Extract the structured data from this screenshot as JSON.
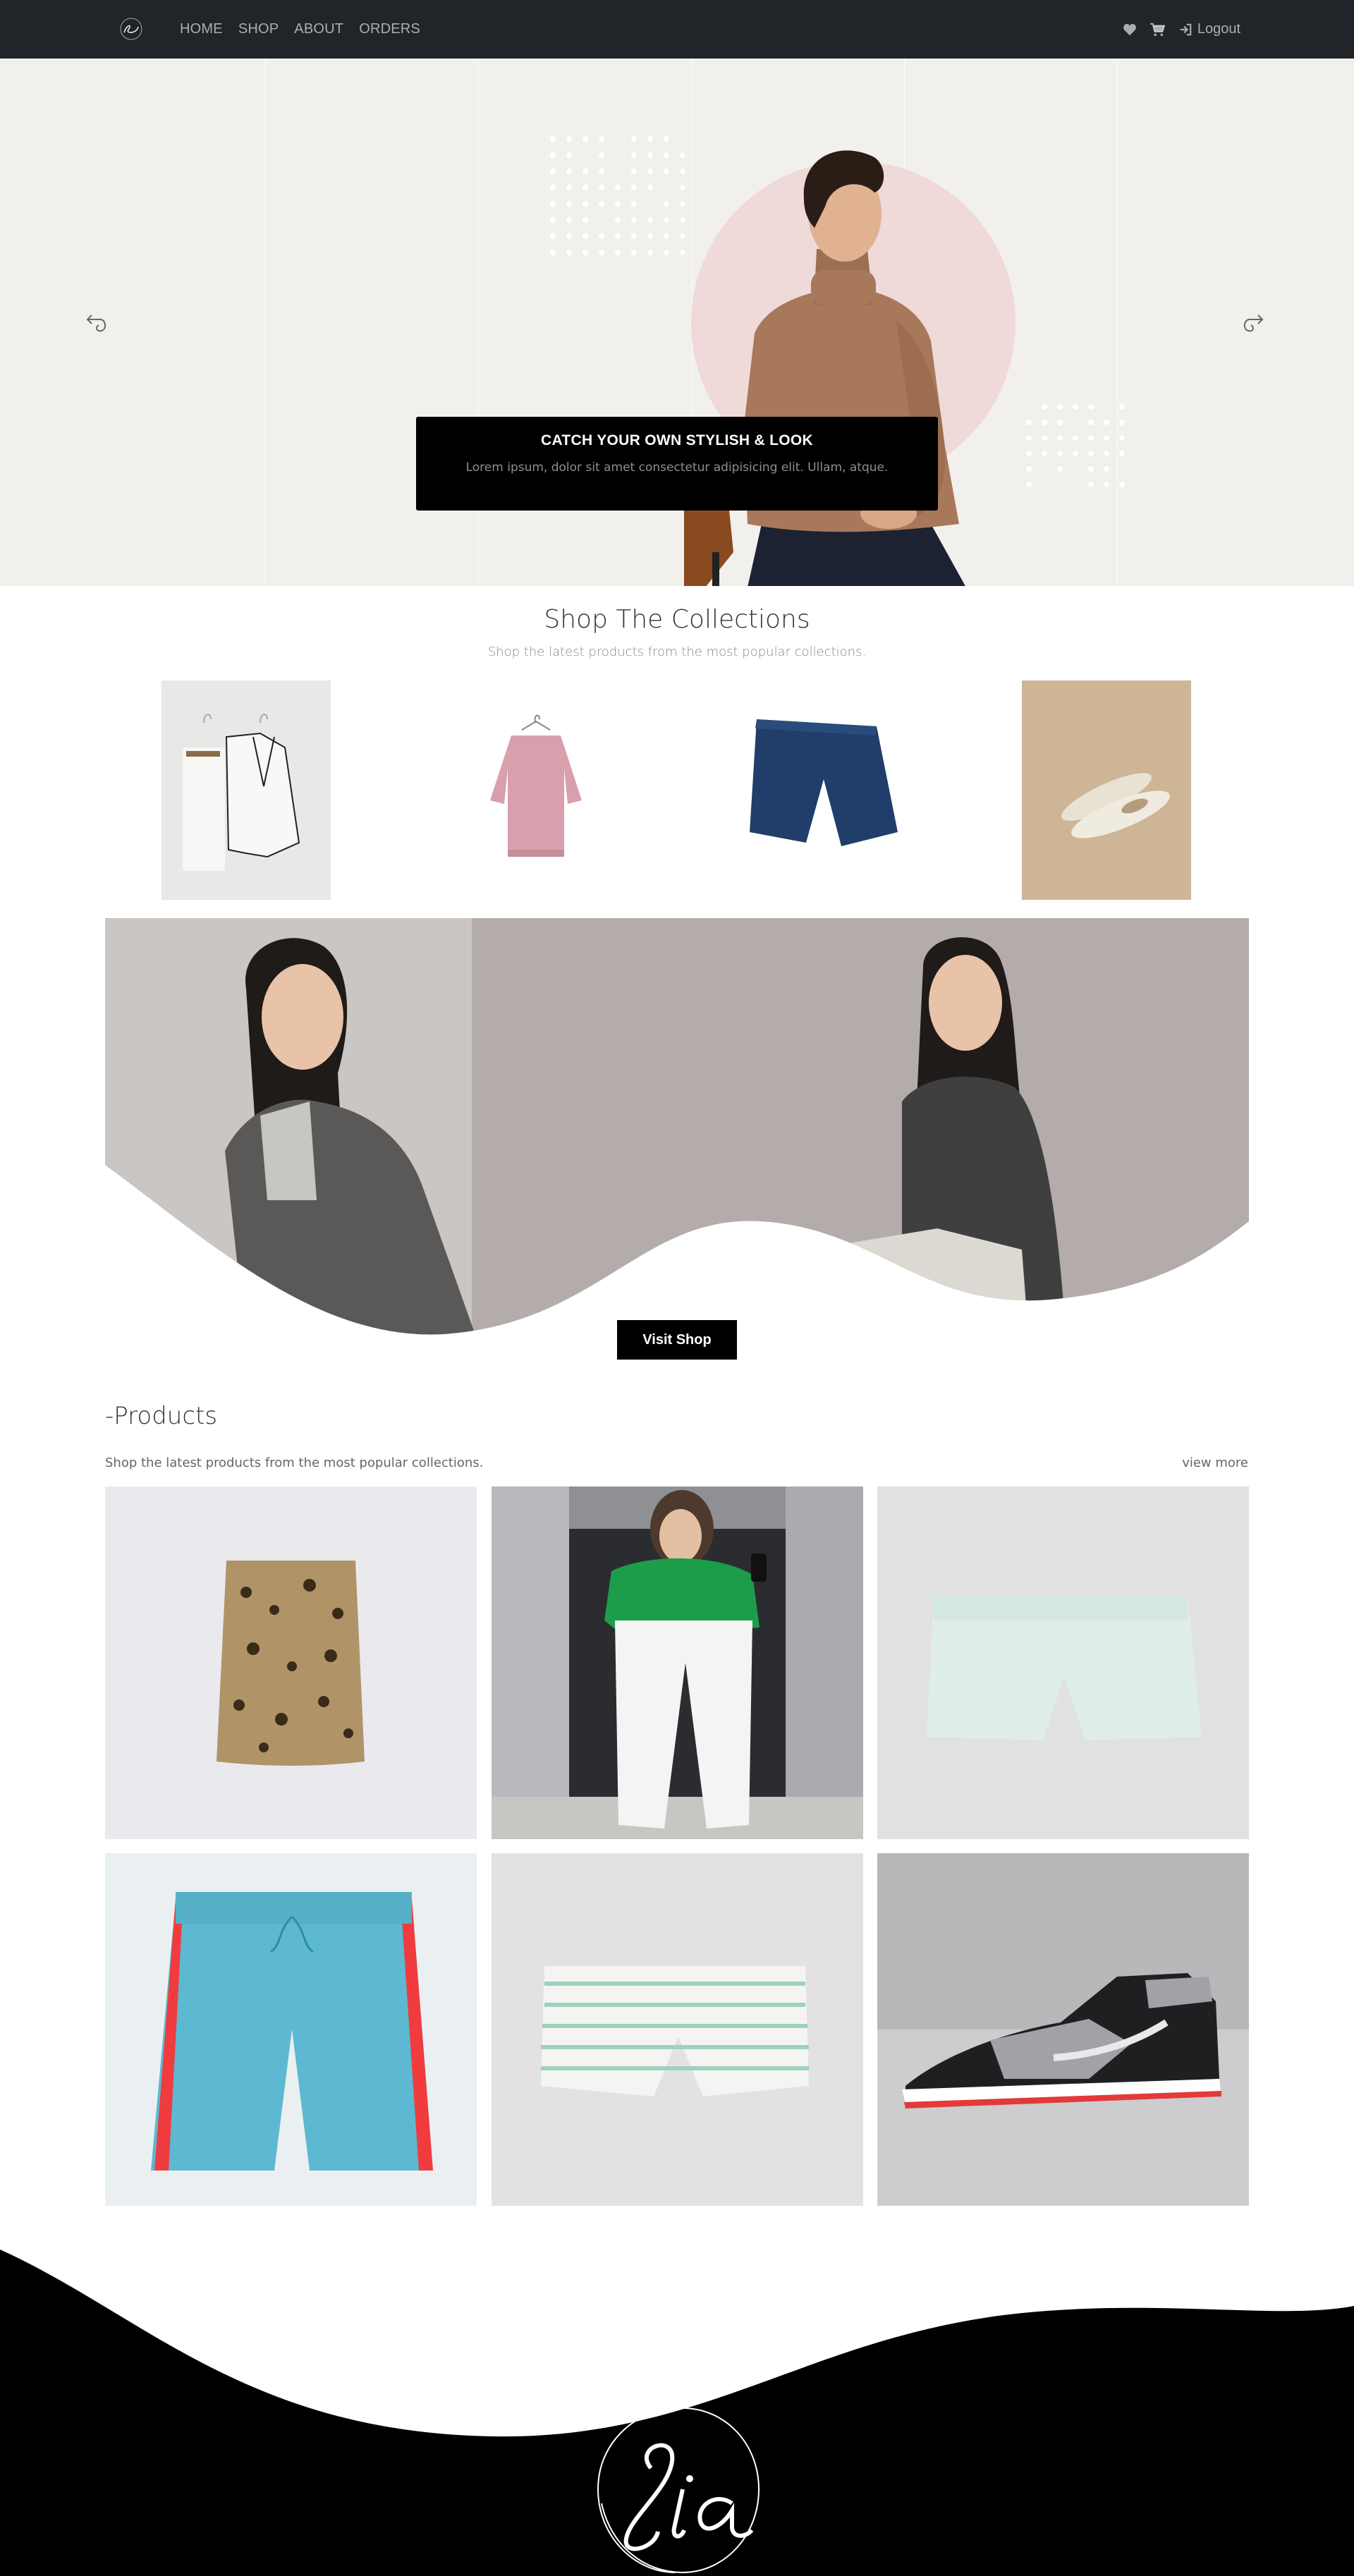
{
  "navbar": {
    "brand": "Sia",
    "links": [
      {
        "label": "HOME"
      },
      {
        "label": "SHOP"
      },
      {
        "label": "ABOUT"
      },
      {
        "label": "ORDERS"
      }
    ],
    "icons": [
      "heart-icon",
      "cart-icon",
      "sign-out-icon"
    ],
    "logout_label": "Logout"
  },
  "hero": {
    "caption_title": "CATCH YOUR OWN STYLISH & LOOK",
    "caption_text": "Lorem ipsum, dolor sit amet consectetur adipisicing elit. Ullam, atque.",
    "prev_icon": "arrow-left-curved-icon",
    "next_icon": "arrow-right-curved-icon"
  },
  "collections": {
    "title": "Shop The Collections",
    "subtitle": "Shop the latest products from the most popular collections.",
    "items": [
      "white-suit-set",
      "pink-sweater",
      "navy-shorts",
      "cream-loafers"
    ]
  },
  "banner": {
    "button_label": "Visit Shop"
  },
  "products": {
    "title": "-Products",
    "subtitle": "Shop the latest products from the most popular collections.",
    "view_more": "view more",
    "items": [
      "leopard-skirt",
      "green-top-white-pants",
      "mint-shorts",
      "blue-sport-shorts",
      "striped-shorts",
      "sneaker"
    ]
  },
  "footer": {
    "brand": "Sia"
  },
  "colors": {
    "navbar_bg": "#212529",
    "hero_bg": "#f2f0ed",
    "accent_pink": "#f0d9d9",
    "black": "#000000"
  }
}
